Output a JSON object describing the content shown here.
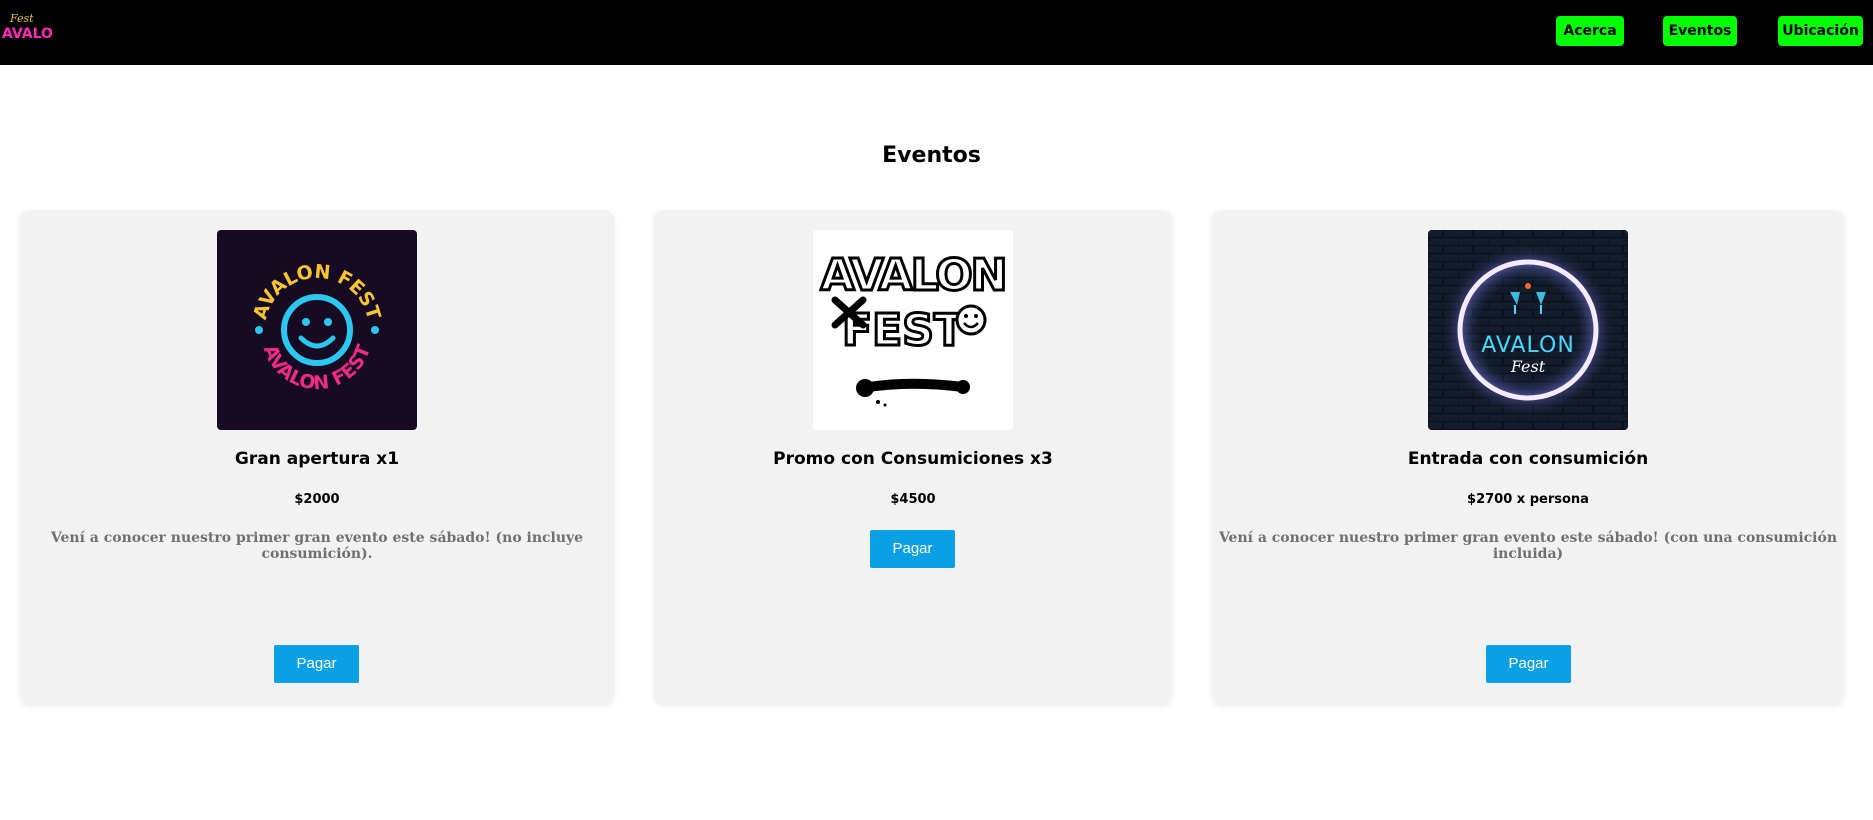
{
  "header": {
    "logo": {
      "name": "avalon-fest-logo",
      "text": "AVALON",
      "script_text": "Fest"
    },
    "nav": [
      {
        "label": "Acerca"
      },
      {
        "label": "Eventos"
      },
      {
        "label": "Ubicación"
      }
    ]
  },
  "main": {
    "title": "Eventos",
    "cards": [
      {
        "title": "Gran apertura x1",
        "price": "$2000",
        "description": "Vení a conocer nuestro primer gran evento este sábado! (no incluye consumición).",
        "button": "Pagar",
        "image": {
          "name": "avalon-fest-smiley-badge",
          "colors": {
            "bg": "#170b23",
            "yellow": "#f7c531",
            "cyan": "#2dc6f0",
            "pink": "#ef2b86"
          }
        }
      },
      {
        "title": "Promo con Consumiciones x3",
        "price": "$4500",
        "description": "",
        "button": "Pagar",
        "image": {
          "name": "avalon-fest-graffiti-logo",
          "colors": {
            "bg": "#ffffff",
            "ink": "#000000"
          }
        }
      },
      {
        "title": "Entrada con consumición",
        "price": "$2700 x persona",
        "description": "Vení a conocer nuestro primer gran evento este sábado! (con una consumición incluida)",
        "button": "Pagar",
        "image": {
          "name": "avalon-fest-neon-sign",
          "colors": {
            "bg": "#101826",
            "ring": "#f5eaff",
            "neon": "#46d8ff"
          }
        }
      }
    ]
  },
  "colors": {
    "nav_bg": "#000000",
    "nav_button": "#00ff00",
    "pay_button": "#0aa0e6",
    "card_bg": "#f2f2f2"
  }
}
